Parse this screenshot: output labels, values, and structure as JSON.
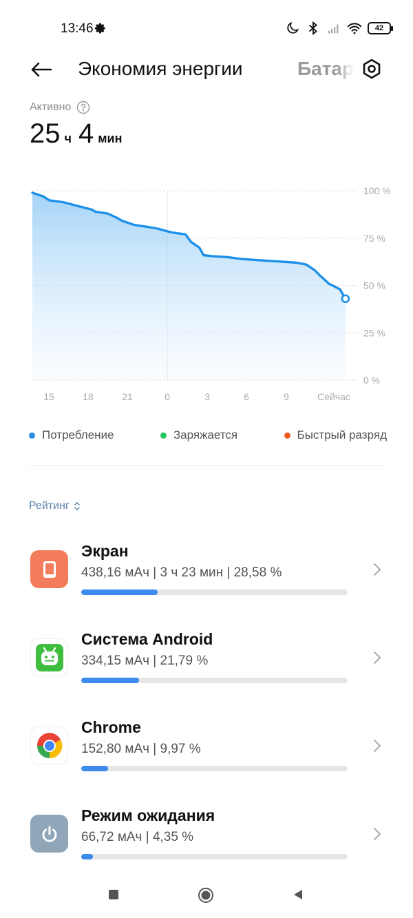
{
  "status_bar": {
    "time": "13:46",
    "battery_level": "42",
    "icons": [
      "gear-icon",
      "moon-icon",
      "bluetooth-icon",
      "signal-icon",
      "wifi-icon",
      "battery-icon"
    ]
  },
  "header": {
    "title": "Экономия энергии",
    "tab_battery": "Батарея",
    "back_icon": "back-arrow-icon",
    "settings_icon": "settings-icon"
  },
  "active": {
    "label": "Активно",
    "hours": "25",
    "hours_unit": "ч",
    "minutes": "4",
    "minutes_unit": "мин"
  },
  "chart_data": {
    "type": "area",
    "x_tick_labels": [
      "15",
      "18",
      "21",
      "0",
      "3",
      "6",
      "9",
      "Сейчас"
    ],
    "y_tick_labels": [
      "100 %",
      "75 %",
      "50 %",
      "25 %",
      "0 %"
    ],
    "ylim": [
      0,
      100
    ],
    "xlim": [
      14,
      37
    ],
    "grid": true,
    "series": [
      {
        "color": "#1e90e8",
        "x": [
          14.0,
          14.8,
          15.2,
          16.2,
          18.3,
          18.5,
          19.4,
          20.0,
          20.5,
          21.3,
          22.2,
          23.0,
          24.0,
          25.0,
          25.4,
          26.0,
          26.3,
          26.9,
          28.0,
          29.0,
          30.0,
          31.0,
          32.0,
          33.0,
          33.7,
          34.3,
          34.7,
          35.3,
          36.1,
          36.5
        ],
        "y": [
          99,
          97,
          95,
          94,
          90,
          89,
          88,
          86,
          84,
          82,
          81,
          80,
          78,
          77,
          73,
          70,
          66,
          65.5,
          65,
          64,
          63.5,
          63,
          62.5,
          62,
          61,
          58,
          55,
          51,
          48,
          43
        ]
      }
    ]
  },
  "legend": [
    {
      "label": "Потребление",
      "color": "#2a8de8"
    },
    {
      "label": "Заряжается",
      "color": "#22c55e"
    },
    {
      "label": "Быстрый разряд",
      "color": "#ef5a1e"
    }
  ],
  "rating": {
    "label": "Рейтинг"
  },
  "apps": [
    {
      "name": "Экран",
      "detail": "438,16 мАч | 3 ч 23 мин  | 28,58 %",
      "percent": 28.58,
      "icon": "screen-icon",
      "icon_bg": "#f27c5c"
    },
    {
      "name": "Система Android",
      "detail": "334,15 мАч | 21,79 %",
      "percent": 21.79,
      "icon": "android-icon",
      "icon_bg": "#3ebd3e"
    },
    {
      "name": "Chrome",
      "detail": "152,80 мАч | 9,97 %",
      "percent": 9.97,
      "icon": "chrome-icon",
      "icon_bg": "#ffffff"
    },
    {
      "name": "Режим ожидания",
      "detail": "66,72 мАч | 4,35 %",
      "percent": 4.35,
      "icon": "power-icon",
      "icon_bg": "#8fa6b8"
    }
  ],
  "nav": {
    "icons": [
      "square-icon",
      "home-circle-icon",
      "back-triangle-icon"
    ]
  }
}
